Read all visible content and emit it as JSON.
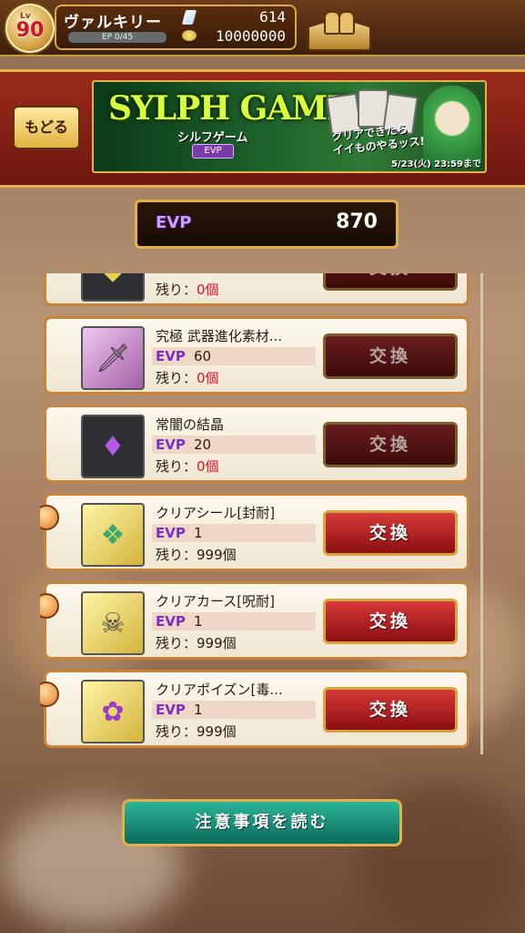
{
  "player": {
    "level_prefix": "Lv",
    "level": "90",
    "name": "ヴァルキリー",
    "ep": "EP 0/45",
    "gems": "614",
    "coins": "10000000"
  },
  "header": {
    "back_label": "もどる",
    "banner_title": "SYLPH GAME",
    "banner_sub": "シルフゲーム",
    "banner_tag": "EVP",
    "banner_caption_1": "クリアできたら",
    "banner_caption_2": "イイものやるッス!",
    "banner_deadline": "5/23(火) 23:59まで"
  },
  "evp": {
    "label": "EVP",
    "value": "870"
  },
  "items": [
    {
      "name": "",
      "evp": "",
      "remaining_label": "残り：",
      "remaining": "0個",
      "button": "交換",
      "enabled": false,
      "icon": "light-material-icon"
    },
    {
      "name": "究極 武器進化素材...",
      "evp": "60",
      "remaining_label": "残り：",
      "remaining": "0個",
      "button": "交換",
      "enabled": false,
      "icon": "sword-icon"
    },
    {
      "name": "常闇の結晶",
      "evp": "20",
      "remaining_label": "残り：",
      "remaining": "0個",
      "button": "交換",
      "enabled": false,
      "icon": "purple-crystal-icon"
    },
    {
      "name": "クリアシール[封耐]",
      "evp": "1",
      "remaining_label": "残り：",
      "remaining": "999個",
      "button": "交換",
      "enabled": true,
      "icon": "seal-icon"
    },
    {
      "name": "クリアカース[呪耐]",
      "evp": "1",
      "remaining_label": "残り：",
      "remaining": "999個",
      "button": "交換",
      "enabled": true,
      "icon": "skull-icon"
    },
    {
      "name": "クリアポイズン[毒...",
      "evp": "1",
      "remaining_label": "残り：",
      "remaining": "999個",
      "button": "交換",
      "enabled": true,
      "icon": "poison-icon"
    }
  ],
  "footer": {
    "notice_label": "注意事項を読む"
  },
  "colors": {
    "accent_gold": "#e2b14a",
    "exchange_red": "#d63838",
    "evp_purple": "#7a2fc8",
    "zero_red": "#e0132a"
  }
}
